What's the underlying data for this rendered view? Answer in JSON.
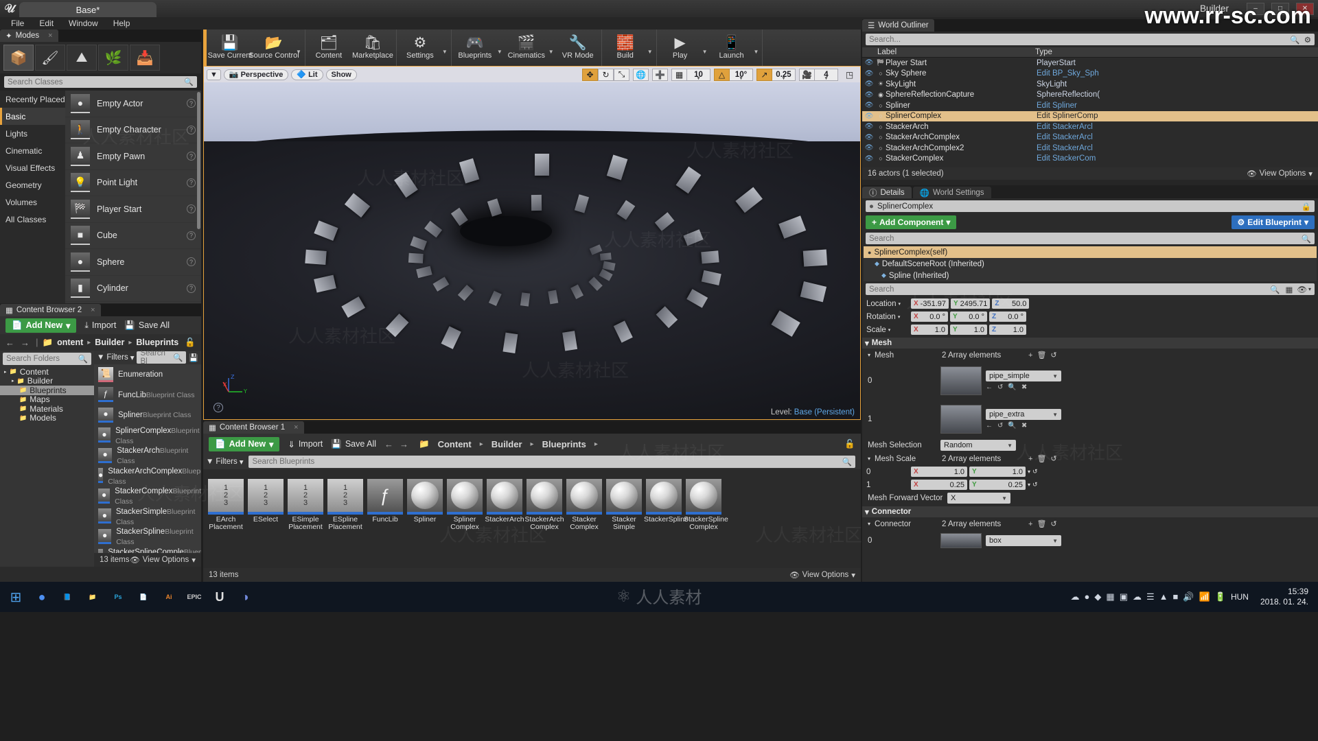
{
  "window": {
    "project_tab": "Base*",
    "right_label": "Builder",
    "minimize": "–",
    "maximize": "□",
    "close": "✕",
    "watermark": "www.rr-sc.com",
    "bottom_watermark": "人人素材"
  },
  "menubar": {
    "items": [
      "File",
      "Edit",
      "Window",
      "Help"
    ]
  },
  "modes": {
    "tab_label": "Modes",
    "tab_close": "×",
    "buttons": [
      {
        "name": "place-mode",
        "glyph": "📦",
        "active": true
      },
      {
        "name": "paint-mode",
        "glyph": "🖌",
        "active": false
      },
      {
        "name": "landscape-mode",
        "glyph": "⛰",
        "active": false
      },
      {
        "name": "foliage-mode",
        "glyph": "🌿",
        "active": false
      },
      {
        "name": "geometry-edit-mode",
        "glyph": "📥",
        "active": false
      }
    ],
    "search_placeholder": "Search Classes",
    "categories": [
      {
        "label": "Recently Placed",
        "selected": false
      },
      {
        "label": "Basic",
        "selected": true
      },
      {
        "label": "Lights",
        "selected": false
      },
      {
        "label": "Cinematic",
        "selected": false
      },
      {
        "label": "Visual Effects",
        "selected": false
      },
      {
        "label": "Geometry",
        "selected": false
      },
      {
        "label": "Volumes",
        "selected": false
      },
      {
        "label": "All Classes",
        "selected": false
      }
    ],
    "actors": [
      {
        "label": "Empty Actor",
        "glyph": "●"
      },
      {
        "label": "Empty Character",
        "glyph": "🚶"
      },
      {
        "label": "Empty Pawn",
        "glyph": "♟"
      },
      {
        "label": "Point Light",
        "glyph": "💡"
      },
      {
        "label": "Player Start",
        "glyph": "🏁"
      },
      {
        "label": "Cube",
        "glyph": "■"
      },
      {
        "label": "Sphere",
        "glyph": "●"
      },
      {
        "label": "Cylinder",
        "glyph": "▮"
      }
    ],
    "help_glyph": "?"
  },
  "toolbar": {
    "groups": [
      {
        "items": [
          {
            "label": "Save Current",
            "glyph": "💾",
            "caret": false
          },
          {
            "label": "Source Control",
            "glyph": "📂",
            "caret": true
          }
        ]
      },
      {
        "items": [
          {
            "label": "Content",
            "glyph": "🗂",
            "caret": false
          },
          {
            "label": "Marketplace",
            "glyph": "🛍",
            "caret": false
          }
        ]
      },
      {
        "items": [
          {
            "label": "Settings",
            "glyph": "⚙",
            "caret": true
          }
        ]
      },
      {
        "items": [
          {
            "label": "Blueprints",
            "glyph": "🎮",
            "caret": true
          },
          {
            "label": "Cinematics",
            "glyph": "🎬",
            "caret": true
          },
          {
            "label": "VR Mode",
            "glyph": "🔧",
            "caret": false
          }
        ]
      },
      {
        "items": [
          {
            "label": "Build",
            "glyph": "🧱",
            "caret": true
          }
        ]
      },
      {
        "items": [
          {
            "label": "Play",
            "glyph": "▶",
            "caret": true
          },
          {
            "label": "Launch",
            "glyph": "📱",
            "caret": true
          }
        ]
      }
    ]
  },
  "viewport": {
    "menu_caret": "▼",
    "perspective": "Perspective",
    "perspective_icon": "📷",
    "lit": "Lit",
    "lit_icon": "🔷",
    "show": "Show",
    "transform_modes": [
      {
        "name": "translate",
        "glyph": "✥",
        "active": true
      },
      {
        "name": "rotate",
        "glyph": "↻",
        "active": false
      },
      {
        "name": "scale",
        "glyph": "⤡",
        "active": false
      }
    ],
    "coord_system": {
      "glyph": "🌐",
      "active": false
    },
    "surface_snap": {
      "glyph": "➕",
      "active": false
    },
    "grid_snap": {
      "glyph": "▦",
      "active": false,
      "value": "10"
    },
    "angle_snap": {
      "glyph": "△",
      "active": true,
      "value": "10°"
    },
    "scale_snap": {
      "glyph": "↗",
      "active": true,
      "value": "0.25"
    },
    "camera_speed": {
      "glyph": "🎥",
      "value": "4"
    },
    "maximize_glyph": "◳",
    "axis": {
      "x": "X",
      "y": "Y",
      "z": "Z"
    },
    "help_glyph": "?",
    "level_label": "Level:",
    "level_name": "Base (Persistent)"
  },
  "content_browser_2": {
    "tab_label": "Content Browser 2",
    "tab_icon": "▦",
    "tab_close": "×",
    "add_new": "Add New",
    "add_new_caret": "▾",
    "import": "Import",
    "save_all": "Save All",
    "import_icon": "⤓",
    "save_icon": "💾",
    "nav_back": "←",
    "nav_forward": "→",
    "crumb_folder_icon": "📁",
    "breadcrumbs": [
      "ontent",
      "Builder",
      "Blueprints"
    ],
    "crumb_sep": "▸",
    "lock_icon": "🔓",
    "folder_search_placeholder": "Search Folders",
    "folder_tree": [
      {
        "label": "Content",
        "depth": 0,
        "arrow": "▸",
        "selected": false
      },
      {
        "label": "Builder",
        "depth": 1,
        "arrow": "▸",
        "selected": false
      },
      {
        "label": "Blueprints",
        "depth": 2,
        "arrow": "",
        "selected": true
      },
      {
        "label": "Maps",
        "depth": 2,
        "arrow": "",
        "selected": false
      },
      {
        "label": "Materials",
        "depth": 2,
        "arrow": "",
        "selected": false
      },
      {
        "label": "Models",
        "depth": 2,
        "arrow": "",
        "selected": false
      }
    ],
    "filters_label": "Filters",
    "filters_caret": "▾",
    "filters_icon": "▼",
    "asset_search_placeholder": "Search Bl",
    "save_small_icon": "💾",
    "assets": [
      {
        "name": "Enumeration",
        "type": "",
        "kind": "enum",
        "glyph": "📜"
      },
      {
        "name": "FuncLib",
        "type": "Blueprint Class",
        "kind": "func",
        "glyph": "ƒ"
      },
      {
        "name": "Spliner",
        "type": "Blueprint Class",
        "kind": "bp",
        "glyph": "●"
      },
      {
        "name": "SplinerComplex",
        "type": "Blueprint Class",
        "kind": "bp",
        "glyph": "●"
      },
      {
        "name": "StackerArch",
        "type": "Blueprint Class",
        "kind": "bp",
        "glyph": "●"
      },
      {
        "name": "StackerArchComplex",
        "type": "Blueprint Class",
        "kind": "bp",
        "glyph": "●"
      },
      {
        "name": "StackerComplex",
        "type": "Blueprint Class",
        "kind": "bp",
        "glyph": "●"
      },
      {
        "name": "StackerSimple",
        "type": "Blueprint Class",
        "kind": "bp",
        "glyph": "●"
      },
      {
        "name": "StackerSpline",
        "type": "Blueprint Class",
        "kind": "bp",
        "glyph": "●"
      },
      {
        "name": "StackerSplineComple",
        "type": "Blueprint Class",
        "kind": "bp",
        "glyph": "●"
      }
    ],
    "status_count": "13 items",
    "view_options": "View Options",
    "view_options_icon": "👁",
    "view_options_caret": "▾"
  },
  "content_browser_1": {
    "tab_label": "Content Browser 1",
    "tab_icon": "▦",
    "tab_close": "×",
    "add_new": "Add New",
    "add_new_caret": "▾",
    "import": "Import",
    "save_all": "Save All",
    "nav_back": "←",
    "nav_forward": "→",
    "breadcrumbs": [
      "Content",
      "Builder",
      "Blueprints"
    ],
    "crumb_sep": "▸",
    "crumb_folder_icon": "📁",
    "lock_icon": "🔓",
    "filters_label": "Filters",
    "filters_caret": "▾",
    "search_placeholder": "Search Blueprints",
    "tiles": [
      {
        "label": "EArch Placement",
        "kind": "enum"
      },
      {
        "label": "ESelect",
        "kind": "enum"
      },
      {
        "label": "ESimple Placement",
        "kind": "enum"
      },
      {
        "label": "ESpline Placement",
        "kind": "enum"
      },
      {
        "label": "FuncLib",
        "kind": "func"
      },
      {
        "label": "Spliner",
        "kind": "bp"
      },
      {
        "label": "Spliner Complex",
        "kind": "bp"
      },
      {
        "label": "StackerArch",
        "kind": "bp"
      },
      {
        "label": "StackerArch Complex",
        "kind": "bp"
      },
      {
        "label": "Stacker Complex",
        "kind": "bp"
      },
      {
        "label": "Stacker Simple",
        "kind": "bp"
      },
      {
        "label": "StackerSpline",
        "kind": "bp"
      },
      {
        "label": "StackerSpline Complex",
        "kind": "bp"
      }
    ],
    "status_count": "13 items",
    "view_options": "View Options",
    "view_options_icon": "👁",
    "view_options_caret": "▾"
  },
  "outliner": {
    "tab_label": "World Outliner",
    "tab_icon": "☰",
    "search_placeholder": "Search...",
    "settings_icon": "⚙",
    "search_icon": "🔍",
    "col_label": "Label",
    "col_type": "Type",
    "sort_caret": "▲",
    "rows": [
      {
        "label": "Player Start",
        "type": "PlayerStart",
        "icon": "🏁",
        "selected": false,
        "link": false
      },
      {
        "label": "Sky Sphere",
        "type": "Edit BP_Sky_Sph",
        "icon": "○",
        "selected": false,
        "link": true
      },
      {
        "label": "SkyLight",
        "type": "SkyLight",
        "icon": "☀",
        "selected": false,
        "link": false
      },
      {
        "label": "SphereReflectionCapture",
        "type": "SphereReflection(",
        "icon": "◉",
        "selected": false,
        "link": false
      },
      {
        "label": "Spliner",
        "type": "Edit Spliner",
        "icon": "○",
        "selected": false,
        "link": true
      },
      {
        "label": "SplinerComplex",
        "type": "Edit SplinerComp",
        "icon": "○",
        "selected": true,
        "link": true
      },
      {
        "label": "StackerArch",
        "type": "Edit StackerArcl",
        "icon": "○",
        "selected": false,
        "link": true
      },
      {
        "label": "StackerArchComplex",
        "type": "Edit StackerArcl",
        "icon": "○",
        "selected": false,
        "link": true
      },
      {
        "label": "StackerArchComplex2",
        "type": "Edit StackerArcl",
        "icon": "○",
        "selected": false,
        "link": true
      },
      {
        "label": "StackerComplex",
        "type": "Edit StackerCom",
        "icon": "○",
        "selected": false,
        "link": true
      }
    ],
    "status": "16 actors (1 selected)",
    "view_options": "View Options",
    "view_options_icon": "👁",
    "view_options_caret": "▾"
  },
  "details": {
    "tabs": [
      {
        "label": "Details",
        "icon": "ⓘ",
        "active": true
      },
      {
        "label": "World Settings",
        "icon": "🌐",
        "active": false
      }
    ],
    "actor_name": "SplinerComplex",
    "actor_icon": "●",
    "lock_icon": "🔒",
    "add_component": "Add Component",
    "add_component_plus": "+",
    "add_component_caret": "▾",
    "edit_blueprint": "Edit Blueprint",
    "edit_blueprint_icon": "⚙",
    "edit_blueprint_caret": "▾",
    "comp_search_placeholder": "Search",
    "components": [
      {
        "label": "SplinerComplex(self)",
        "icon": "●",
        "selected": true,
        "indent": 0
      },
      {
        "label": "DefaultSceneRoot (Inherited)",
        "icon": "◆",
        "selected": false,
        "indent": 1
      },
      {
        "label": "Spline (Inherited)",
        "icon": "◆",
        "selected": false,
        "indent": 2
      }
    ],
    "prop_search_placeholder": "Search",
    "grid_icon": "▦",
    "eye_icon": "👁",
    "eye_caret": "▾",
    "transform": [
      {
        "label": "Location",
        "caret": "▾",
        "x": "-351.97",
        "y": "2495.71",
        "z": "50.0"
      },
      {
        "label": "Rotation",
        "caret": "▾",
        "x": "0.0 °",
        "y": "0.0 °",
        "z": "0.0 °"
      },
      {
        "label": "Scale",
        "caret": "▾",
        "x": "1.0",
        "y": "1.0",
        "z": "1.0"
      }
    ],
    "sections": {
      "mesh": {
        "title": "Mesh",
        "caret": "▾",
        "array_label": "Mesh",
        "array_count": "2 Array elements",
        "add_icon": "+",
        "del_icon": "🗑",
        "reset_icon": "↺",
        "elements": [
          {
            "index": "0",
            "value": "pipe_simple"
          },
          {
            "index": "1",
            "value": "pipe_extra"
          }
        ],
        "element_caret": "▾",
        "row_icons": [
          "←",
          "↺",
          "🔍",
          "✖"
        ],
        "mesh_selection_label": "Mesh Selection",
        "mesh_selection_value": "Random",
        "mesh_scale_label": "Mesh Scale",
        "mesh_scale_count": "2 Array elements",
        "mesh_scale_rows": [
          {
            "index": "0",
            "x": "1.0",
            "y": "1.0"
          },
          {
            "index": "1",
            "x": "0.25",
            "y": "0.25"
          }
        ],
        "forward_vector_label": "Mesh Forward Vector",
        "forward_vector_value": "X"
      },
      "connector": {
        "title": "Connector",
        "caret": "▾",
        "array_label": "Connector",
        "array_count": "2 Array elements",
        "elements": [
          {
            "index": "0",
            "value": "box"
          }
        ]
      }
    }
  },
  "taskbar": {
    "start_glyph": "⊞",
    "items": [
      {
        "name": "chrome",
        "glyph": "●",
        "color": "#4d8ff0"
      },
      {
        "name": "explorer-blue",
        "glyph": "📘",
        "color": "#3f6fbf"
      },
      {
        "name": "file-explorer",
        "glyph": "📁",
        "color": "#e8b84b"
      },
      {
        "name": "photoshop",
        "glyph": "Ps",
        "color": "#2aa3d8"
      },
      {
        "name": "notepad",
        "glyph": "📄",
        "color": "#d8d8d8"
      },
      {
        "name": "illustrator",
        "glyph": "Ai",
        "color": "#e8832b"
      },
      {
        "name": "epic-launcher",
        "glyph": "EPIC",
        "color": "#cfcfcf"
      },
      {
        "name": "unreal-editor",
        "glyph": "U",
        "color": "#e0e0e0"
      },
      {
        "name": "discord",
        "glyph": "◑",
        "color": "#7289da"
      }
    ],
    "tray_icons": [
      "☁",
      "●",
      "◆",
      "▦",
      "▣",
      "☁",
      "☰",
      "▲",
      "■",
      "🔊",
      "📶",
      "🔋"
    ],
    "lang": "HUN",
    "time": "15:39",
    "date": "2018. 01. 24."
  }
}
